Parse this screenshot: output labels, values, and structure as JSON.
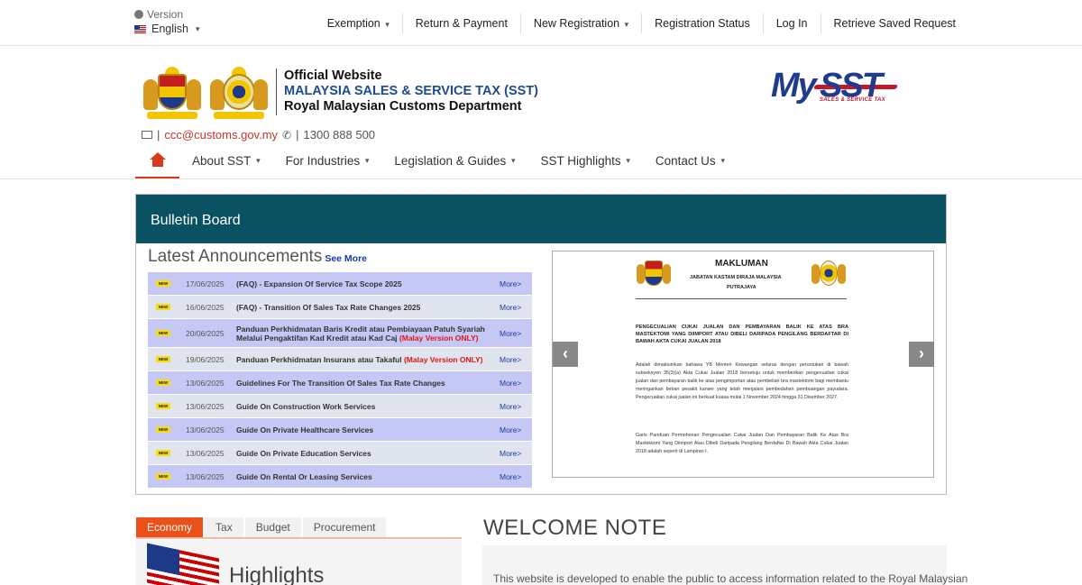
{
  "topbar": {
    "version_label": "Version",
    "language": "English",
    "nav": [
      "Exemption",
      "Return & Payment",
      "New Registration",
      "Registration Status",
      "Log In",
      "Retrieve Saved Request"
    ]
  },
  "header": {
    "title1": "Official Website",
    "title2": "MALAYSIA SALES & SERVICE TAX (SST)",
    "title3": "Royal Malaysian Customs Department",
    "logo_my": "My",
    "logo_sst": "SST",
    "logo_tag": "SALES & SERVICE TAX",
    "email": "ccc@customs.gov.my",
    "phone": "1300 888 500"
  },
  "mainnav": [
    "About SST",
    "For Industries",
    "Legislation & Guides",
    "SST Highlights",
    "Contact Us"
  ],
  "bulletin": {
    "heading": "Bulletin Board",
    "announcements_title": "Latest Announcements",
    "see_more": "See More",
    "new_badge": "NEW",
    "more_label": "More>",
    "items": [
      {
        "date": "17/06/2025",
        "title": "(FAQ) - Expansion Of Service Tax Scope 2025",
        "red": ""
      },
      {
        "date": "16/06/2025",
        "title": "(FAQ) - Transition Of Sales Tax Rate Changes 2025",
        "red": ""
      },
      {
        "date": "20/06/2025",
        "title": "Panduan Perkhidmatan Baris Kredit atau Pembiayaan Patuh Syariah Melalui Pengaktifan Kad Kredit atau Kad Caj",
        "red": "(Malay Version ONLY)"
      },
      {
        "date": "19/06/2025",
        "title": "Panduan Perkhidmatan Insurans atau Takaful",
        "red": "(Malay Version ONLY)"
      },
      {
        "date": "13/06/2025",
        "title": "Guidelines For The Transition Of Sales Tax Rate Changes",
        "red": ""
      },
      {
        "date": "13/06/2025",
        "title": "Guide On Construction Work Services",
        "red": ""
      },
      {
        "date": "13/06/2025",
        "title": "Guide On Private Healthcare Services",
        "red": ""
      },
      {
        "date": "13/06/2025",
        "title": "Guide On Private Education Services",
        "red": ""
      },
      {
        "date": "13/06/2025",
        "title": "Guide On Rental Or Leasing Services",
        "red": ""
      }
    ],
    "slide": {
      "heading": "MAKLUMAN",
      "sub1": "JABATAN KASTAM DIRAJA MALAYSIA",
      "sub2": "PUTRAJAYA",
      "bold_para": "PENGECUALIAN CUKAI JUALAN DAN PEMBAYARAN BALIK KE ATAS BRA MASTEKTOMI YANG DIIMPORT ATAU DIBELI DARIPADA PENGILANG BERDAFTAR DI BAWAH AKTA CUKAI JUALAN 2018",
      "para1": "Adalah dimaklumkan bahawa YB Menteri Kewangan selaras dengan peruntukan di bawah subseksyen 35(3)(a) Akta Cukai Jualan 2018 bersetuju untuk memberikan pengecualian cukai jualan dan pembayaran balik ke atas pengimportan atau pembelian bra mastektomi bagi membantu meringankan beban pesakit kanser yang telah menjalani pembedahan pembuangan payudara. Pengecualian cukai jualan ini berkuat kuasa mulai 1 November 2024 hingga 31 Disember 2027.",
      "para2": "Garis Panduan Permohonan Pengecualian Cukai Jualan Dan Pembayaran Balik Ke Atas Bra Mastektomi Yang Diimport Atau Dibeli Daripada Pengilang Berdaftar Di Bawah Akta Cukai Jualan 2018 adalah seperti di Lampiran I."
    }
  },
  "tabs": [
    "Economy",
    "Tax",
    "Budget",
    "Procurement"
  ],
  "highlights_title": "Highlights",
  "welcome": {
    "title": "WELCOME NOTE",
    "text": "This website is developed to enable the public to access information related to the Royal Malaysian"
  }
}
